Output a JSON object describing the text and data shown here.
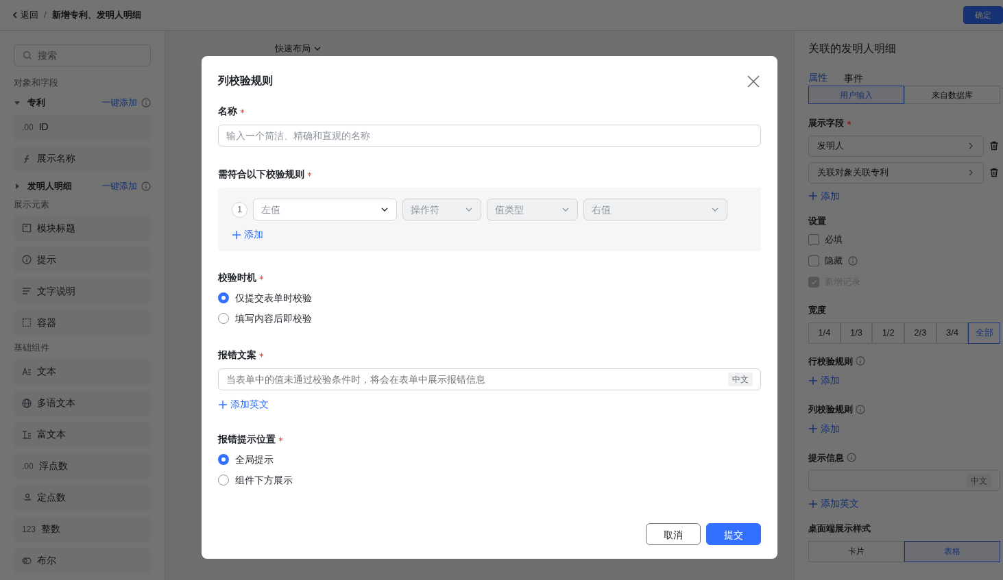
{
  "header": {
    "back": "返回",
    "separator": "/",
    "breadcrumb": "新增专利、发明人明细",
    "confirm": "确定"
  },
  "sidebar": {
    "search_placeholder": "搜索",
    "sections": [
      {
        "title": "对象和字段",
        "groups": [
          {
            "name": "专利",
            "expanded": true,
            "action": "一键添加",
            "items": [
              {
                "label": "ID",
                "icon_text": ".00"
              },
              {
                "label": "展示名称",
                "kind": "formula"
              }
            ]
          },
          {
            "name": "发明人明细",
            "expanded": false,
            "action": "一键添加"
          }
        ]
      },
      {
        "title": "展示元素",
        "items": [
          {
            "label": "模块标题",
            "kind": "title"
          },
          {
            "label": "提示",
            "kind": "info"
          },
          {
            "label": "文字说明",
            "kind": "lines"
          },
          {
            "label": "容器",
            "kind": "container"
          }
        ]
      },
      {
        "title": "基础组件",
        "items": [
          {
            "label": "文本",
            "kind": "text"
          },
          {
            "label": "多语文本",
            "kind": "globe"
          },
          {
            "label": "富文本",
            "kind": "richtext"
          },
          {
            "label": "浮点数",
            "icon_text": ".00"
          },
          {
            "label": "定点数",
            "kind": "fixed"
          },
          {
            "label": "整数",
            "icon_text": "123"
          },
          {
            "label": "布尔",
            "kind": "toggle"
          }
        ]
      }
    ]
  },
  "canvas": {
    "quick_layout": "快速布局"
  },
  "right_panel": {
    "title": "关联的发明人明细",
    "tabs": [
      {
        "label": "属性",
        "selected": true
      },
      {
        "label": "事件",
        "selected": false
      }
    ],
    "source": [
      {
        "label": "用户输入",
        "selected": true
      },
      {
        "label": "来自数据库",
        "selected": false
      }
    ],
    "display_fields_label": "展示字段",
    "display_fields": [
      "发明人",
      "关联对象关联专利"
    ],
    "add": "添加",
    "settings_label": "设置",
    "checkboxes": [
      {
        "label": "必填",
        "checked": false
      },
      {
        "label": "隐藏",
        "checked": false,
        "info": true
      },
      {
        "label": "新增记录",
        "checked": true,
        "disabled": true
      }
    ],
    "width_label": "宽度",
    "widths": [
      {
        "label": "1/4",
        "selected": false
      },
      {
        "label": "1/3",
        "selected": false
      },
      {
        "label": "1/2",
        "selected": false
      },
      {
        "label": "2/3",
        "selected": false
      },
      {
        "label": "3/4",
        "selected": false
      },
      {
        "label": "全部",
        "selected": true
      }
    ],
    "row_rules_label": "行校验规则",
    "row_rules_add": "添加",
    "col_rules_label": "列校验规则",
    "col_rules_add": "添加",
    "hint_label": "提示信息",
    "hint_lang": "中文",
    "hint_add_en": "添加英文",
    "desktop_style_label": "桌面端展示样式",
    "desktop_styles": [
      {
        "label": "卡片",
        "selected": false
      },
      {
        "label": "表格",
        "selected": true
      }
    ]
  },
  "modal": {
    "title": "列校验规则",
    "name_label": "名称",
    "name_placeholder": "输入一个简洁、精确和直观的名称",
    "rules_label": "需符合以下校验规则",
    "rule_number": "1",
    "rule_selects": [
      {
        "placeholder": "左值",
        "disabled": false
      },
      {
        "placeholder": "操作符",
        "disabled": true
      },
      {
        "placeholder": "值类型",
        "disabled": true
      },
      {
        "placeholder": "右值",
        "disabled": true
      }
    ],
    "rules_add": "添加",
    "timing_label": "校验时机",
    "timing_options": [
      {
        "label": "仅提交表单时校验",
        "selected": true
      },
      {
        "label": "填写内容后即校验",
        "selected": false
      }
    ],
    "error_label": "报错文案",
    "error_placeholder": "当表单中的值未通过校验条件时，将会在表单中展示报错信息",
    "error_lang": "中文",
    "error_add_en": "添加英文",
    "position_label": "报错提示位置",
    "position_options": [
      {
        "label": "全局提示",
        "selected": true
      },
      {
        "label": "组件下方展示",
        "selected": false
      }
    ],
    "cancel": "取消",
    "submit": "提交"
  }
}
